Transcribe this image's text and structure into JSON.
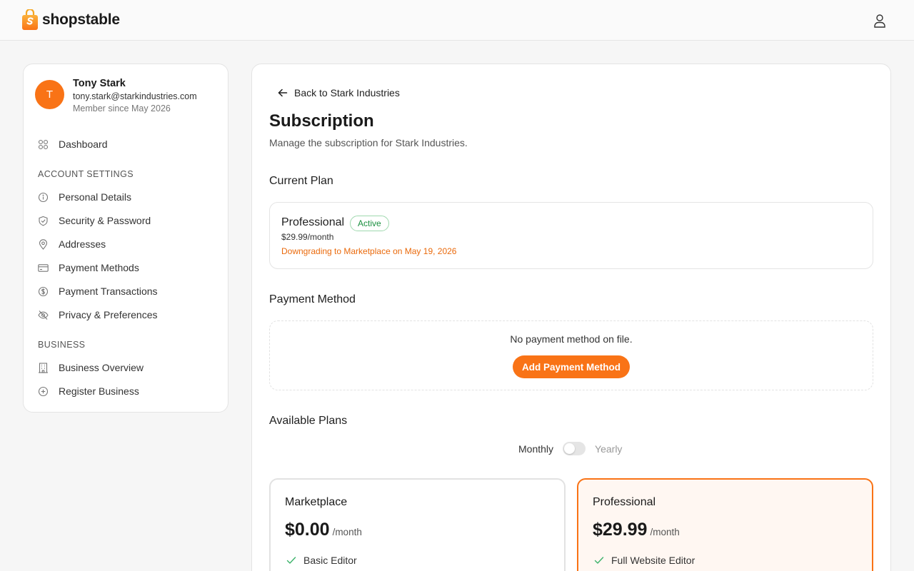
{
  "brand": {
    "name": "shopstable",
    "accent": "#f97316"
  },
  "profile": {
    "initial": "T",
    "name": "Tony Stark",
    "email": "tony.stark@starkindustries.com",
    "member_since": "Member since May 2026"
  },
  "sidebar": {
    "dashboard": "Dashboard",
    "account_section": "ACCOUNT SETTINGS",
    "account_items": [
      {
        "label": "Personal Details",
        "icon": "info-icon"
      },
      {
        "label": "Security & Password",
        "icon": "shield-icon"
      },
      {
        "label": "Addresses",
        "icon": "map-pin-icon"
      },
      {
        "label": "Payment Methods",
        "icon": "credit-card-icon"
      },
      {
        "label": "Payment Transactions",
        "icon": "dollar-circle-icon"
      },
      {
        "label": "Privacy & Preferences",
        "icon": "eye-off-icon"
      }
    ],
    "business_section": "BUSINESS",
    "business_items": [
      {
        "label": "Business Overview",
        "icon": "building-icon"
      },
      {
        "label": "Register Business",
        "icon": "plus-circle-icon"
      }
    ]
  },
  "main": {
    "back_label": "Back to Stark Industries",
    "title": "Subscription",
    "subtitle": "Manage the subscription for Stark Industries.",
    "current_plan": {
      "heading": "Current Plan",
      "name": "Professional",
      "status": "Active",
      "price": "$29.99/month",
      "note": "Downgrading to Marketplace on May 19, 2026"
    },
    "payment_method": {
      "heading": "Payment Method",
      "empty_text": "No payment method on file.",
      "add_button": "Add Payment Method"
    },
    "available_plans": {
      "heading": "Available Plans",
      "toggle_monthly": "Monthly",
      "toggle_yearly": "Yearly",
      "billing": "monthly",
      "plans": [
        {
          "name": "Marketplace",
          "amount": "$0.00",
          "period": "/month",
          "features": [
            "Basic Editor"
          ]
        },
        {
          "name": "Professional",
          "amount": "$29.99",
          "period": "/month",
          "features": [
            "Full Website Editor"
          ],
          "highlighted": true
        }
      ]
    }
  }
}
